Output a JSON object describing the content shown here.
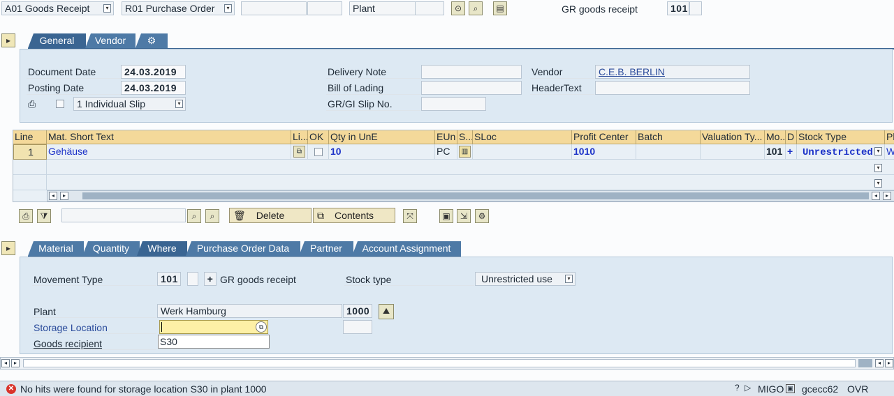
{
  "top": {
    "action": "A01 Goods Receipt",
    "reference": "R01 Purchase Order",
    "plant_label": "Plant",
    "movement_label": "GR goods receipt",
    "movement_code": "101"
  },
  "header_tabs": [
    "General",
    "Vendor"
  ],
  "general": {
    "document_date_label": "Document Date",
    "document_date": "24.03.2019",
    "posting_date_label": "Posting Date",
    "posting_date": "24.03.2019",
    "slip_option": "1 Individual Slip",
    "delivery_note_label": "Delivery Note",
    "bill_of_lading_label": "Bill of Lading",
    "gr_gi_slip_label": "GR/GI Slip No.",
    "vendor_label": "Vendor",
    "vendor_value": "C.E.B. BERLIN",
    "header_text_label": "HeaderText"
  },
  "items_table": {
    "columns": [
      "Line",
      "Mat. Short Text",
      "Li...",
      "OK",
      "Qty in UnE",
      "EUn",
      "S...",
      "SLoc",
      "Profit Center",
      "Batch",
      "Valuation Ty...",
      "Mo...",
      "D",
      "Stock Type",
      "Pl"
    ],
    "row": {
      "line": "1",
      "text": "Gehäuse",
      "qty": "10",
      "unit": "PC",
      "profit_center": "1010",
      "movement": "101",
      "debit": "+",
      "stock_type": "Unrestricted",
      "plant_partial": "W"
    }
  },
  "toolbar": {
    "delete_label": "Delete",
    "contents_label": "Contents"
  },
  "detail_tabs": [
    "Material",
    "Quantity",
    "Where",
    "Purchase Order Data",
    "Partner",
    "Account Assignment"
  ],
  "where": {
    "movement_type_label": "Movement Type",
    "movement_type": "101",
    "debit_sign": "+",
    "movement_text": "GR goods receipt",
    "stock_type_label": "Stock type",
    "stock_type": "Unrestricted use",
    "plant_label": "Plant",
    "plant_name": "Werk Hamburg",
    "plant_code": "1000",
    "storage_location_label": "Storage Location",
    "storage_location_value": "",
    "goods_recipient_label": "Goods recipient",
    "suggestion": "S30"
  },
  "status": {
    "message": "No hits were found for storage location S30 in plant 1000",
    "transaction": "MIGO",
    "server": "gcecc62",
    "mode": "OVR"
  }
}
